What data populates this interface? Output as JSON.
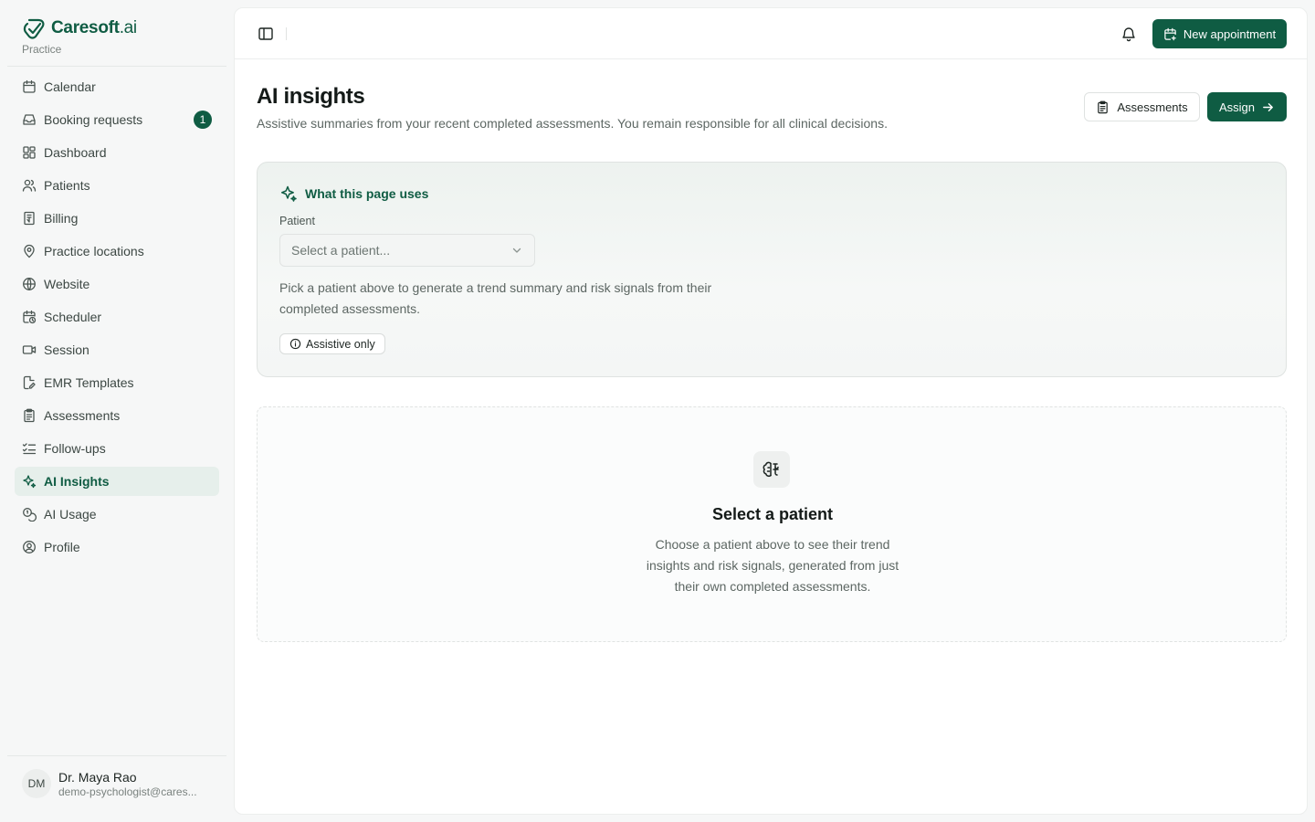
{
  "brand": {
    "name_main": "Caresoft",
    "name_suffix": ".ai",
    "subtitle": "Practice"
  },
  "sidebar": {
    "items": [
      {
        "label": "Calendar",
        "icon": "calendar-icon"
      },
      {
        "label": "Booking requests",
        "icon": "inbox-icon",
        "badge": "1"
      },
      {
        "label": "Dashboard",
        "icon": "dashboard-icon"
      },
      {
        "label": "Patients",
        "icon": "users-icon"
      },
      {
        "label": "Billing",
        "icon": "receipt-icon"
      },
      {
        "label": "Practice locations",
        "icon": "map-pin-icon"
      },
      {
        "label": "Website",
        "icon": "globe-icon"
      },
      {
        "label": "Scheduler",
        "icon": "calendar-clock-icon"
      },
      {
        "label": "Session",
        "icon": "video-icon"
      },
      {
        "label": "EMR Templates",
        "icon": "file-pen-icon"
      },
      {
        "label": "Assessments",
        "icon": "clipboard-icon"
      },
      {
        "label": "Follow-ups",
        "icon": "list-checks-icon"
      },
      {
        "label": "AI Insights",
        "icon": "sparkles-icon",
        "active": true
      },
      {
        "label": "AI Usage",
        "icon": "coins-icon"
      },
      {
        "label": "Profile",
        "icon": "user-circle-icon"
      }
    ]
  },
  "user": {
    "initials": "DM",
    "name": "Dr. Maya Rao",
    "email": "demo-psychologist@cares..."
  },
  "topbar": {
    "new_appointment_label": "New appointment"
  },
  "page": {
    "title": "AI insights",
    "subtitle": "Assistive summaries from your recent completed assessments. You remain responsible for all clinical decisions.",
    "assessments_label": "Assessments",
    "assign_label": "Assign"
  },
  "uses_card": {
    "heading": "What this page uses",
    "patient_label": "Patient",
    "patient_placeholder": "Select a patient...",
    "description": "Pick a patient above to generate a trend summary and risk signals from their completed assessments.",
    "chip_label": "Assistive only"
  },
  "empty_state": {
    "title": "Select a patient",
    "description": "Choose a patient above to see their trend insights and risk signals, generated from just their own completed assessments."
  },
  "colors": {
    "accent": "#0f5c43",
    "active_bg": "#e6efeb"
  }
}
